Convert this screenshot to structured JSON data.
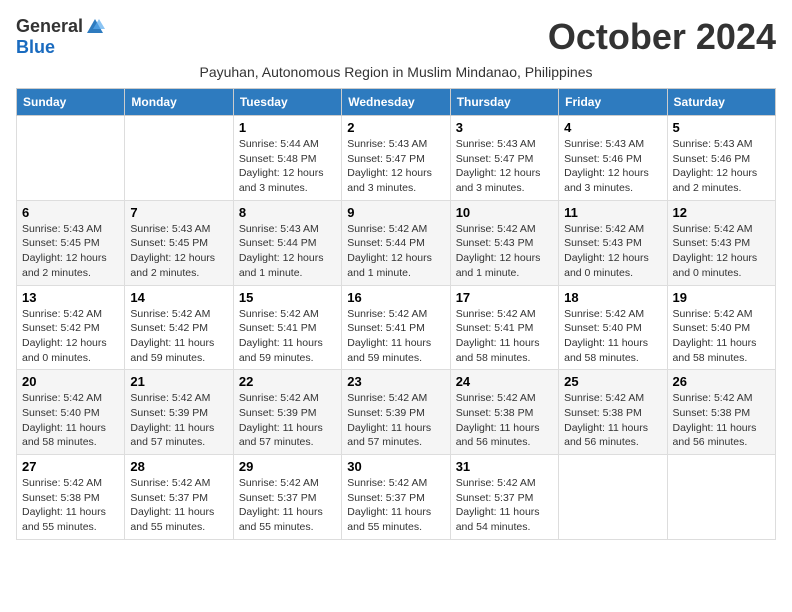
{
  "logo": {
    "general": "General",
    "blue": "Blue"
  },
  "title": "October 2024",
  "subtitle": "Payuhan, Autonomous Region in Muslim Mindanao, Philippines",
  "days_of_week": [
    "Sunday",
    "Monday",
    "Tuesday",
    "Wednesday",
    "Thursday",
    "Friday",
    "Saturday"
  ],
  "weeks": [
    [
      {
        "day": "",
        "info": ""
      },
      {
        "day": "",
        "info": ""
      },
      {
        "day": "1",
        "info": "Sunrise: 5:44 AM\nSunset: 5:48 PM\nDaylight: 12 hours and 3 minutes."
      },
      {
        "day": "2",
        "info": "Sunrise: 5:43 AM\nSunset: 5:47 PM\nDaylight: 12 hours and 3 minutes."
      },
      {
        "day": "3",
        "info": "Sunrise: 5:43 AM\nSunset: 5:47 PM\nDaylight: 12 hours and 3 minutes."
      },
      {
        "day": "4",
        "info": "Sunrise: 5:43 AM\nSunset: 5:46 PM\nDaylight: 12 hours and 3 minutes."
      },
      {
        "day": "5",
        "info": "Sunrise: 5:43 AM\nSunset: 5:46 PM\nDaylight: 12 hours and 2 minutes."
      }
    ],
    [
      {
        "day": "6",
        "info": "Sunrise: 5:43 AM\nSunset: 5:45 PM\nDaylight: 12 hours and 2 minutes."
      },
      {
        "day": "7",
        "info": "Sunrise: 5:43 AM\nSunset: 5:45 PM\nDaylight: 12 hours and 2 minutes."
      },
      {
        "day": "8",
        "info": "Sunrise: 5:43 AM\nSunset: 5:44 PM\nDaylight: 12 hours and 1 minute."
      },
      {
        "day": "9",
        "info": "Sunrise: 5:42 AM\nSunset: 5:44 PM\nDaylight: 12 hours and 1 minute."
      },
      {
        "day": "10",
        "info": "Sunrise: 5:42 AM\nSunset: 5:43 PM\nDaylight: 12 hours and 1 minute."
      },
      {
        "day": "11",
        "info": "Sunrise: 5:42 AM\nSunset: 5:43 PM\nDaylight: 12 hours and 0 minutes."
      },
      {
        "day": "12",
        "info": "Sunrise: 5:42 AM\nSunset: 5:43 PM\nDaylight: 12 hours and 0 minutes."
      }
    ],
    [
      {
        "day": "13",
        "info": "Sunrise: 5:42 AM\nSunset: 5:42 PM\nDaylight: 12 hours and 0 minutes."
      },
      {
        "day": "14",
        "info": "Sunrise: 5:42 AM\nSunset: 5:42 PM\nDaylight: 11 hours and 59 minutes."
      },
      {
        "day": "15",
        "info": "Sunrise: 5:42 AM\nSunset: 5:41 PM\nDaylight: 11 hours and 59 minutes."
      },
      {
        "day": "16",
        "info": "Sunrise: 5:42 AM\nSunset: 5:41 PM\nDaylight: 11 hours and 59 minutes."
      },
      {
        "day": "17",
        "info": "Sunrise: 5:42 AM\nSunset: 5:41 PM\nDaylight: 11 hours and 58 minutes."
      },
      {
        "day": "18",
        "info": "Sunrise: 5:42 AM\nSunset: 5:40 PM\nDaylight: 11 hours and 58 minutes."
      },
      {
        "day": "19",
        "info": "Sunrise: 5:42 AM\nSunset: 5:40 PM\nDaylight: 11 hours and 58 minutes."
      }
    ],
    [
      {
        "day": "20",
        "info": "Sunrise: 5:42 AM\nSunset: 5:40 PM\nDaylight: 11 hours and 58 minutes."
      },
      {
        "day": "21",
        "info": "Sunrise: 5:42 AM\nSunset: 5:39 PM\nDaylight: 11 hours and 57 minutes."
      },
      {
        "day": "22",
        "info": "Sunrise: 5:42 AM\nSunset: 5:39 PM\nDaylight: 11 hours and 57 minutes."
      },
      {
        "day": "23",
        "info": "Sunrise: 5:42 AM\nSunset: 5:39 PM\nDaylight: 11 hours and 57 minutes."
      },
      {
        "day": "24",
        "info": "Sunrise: 5:42 AM\nSunset: 5:38 PM\nDaylight: 11 hours and 56 minutes."
      },
      {
        "day": "25",
        "info": "Sunrise: 5:42 AM\nSunset: 5:38 PM\nDaylight: 11 hours and 56 minutes."
      },
      {
        "day": "26",
        "info": "Sunrise: 5:42 AM\nSunset: 5:38 PM\nDaylight: 11 hours and 56 minutes."
      }
    ],
    [
      {
        "day": "27",
        "info": "Sunrise: 5:42 AM\nSunset: 5:38 PM\nDaylight: 11 hours and 55 minutes."
      },
      {
        "day": "28",
        "info": "Sunrise: 5:42 AM\nSunset: 5:37 PM\nDaylight: 11 hours and 55 minutes."
      },
      {
        "day": "29",
        "info": "Sunrise: 5:42 AM\nSunset: 5:37 PM\nDaylight: 11 hours and 55 minutes."
      },
      {
        "day": "30",
        "info": "Sunrise: 5:42 AM\nSunset: 5:37 PM\nDaylight: 11 hours and 55 minutes."
      },
      {
        "day": "31",
        "info": "Sunrise: 5:42 AM\nSunset: 5:37 PM\nDaylight: 11 hours and 54 minutes."
      },
      {
        "day": "",
        "info": ""
      },
      {
        "day": "",
        "info": ""
      }
    ]
  ]
}
